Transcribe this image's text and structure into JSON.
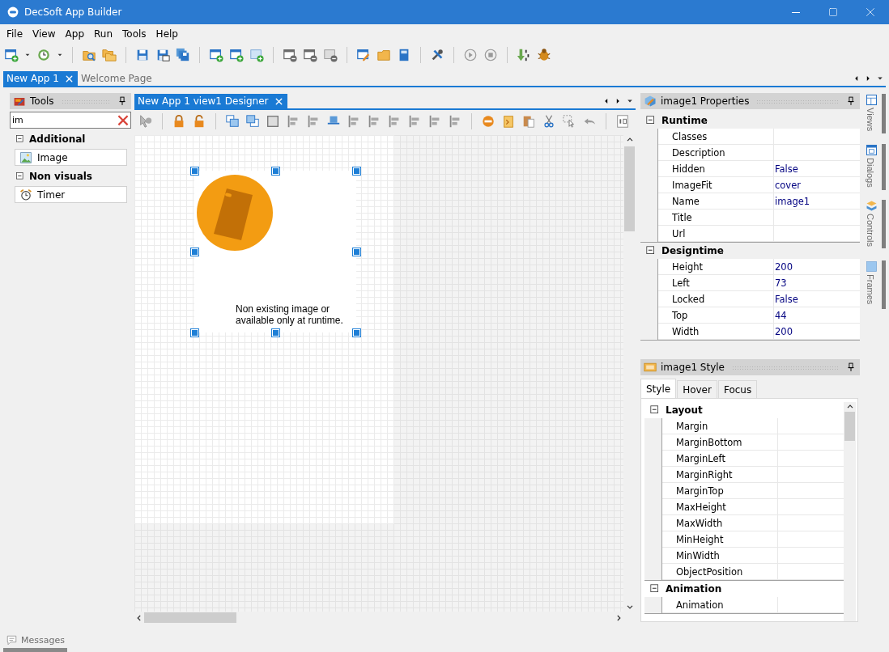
{
  "window": {
    "title": "DecSoft App Builder"
  },
  "menu": [
    "File",
    "View",
    "App",
    "Run",
    "Tools",
    "Help"
  ],
  "doc_tabs": [
    {
      "label": "New App 1",
      "selected": true
    },
    {
      "label": "Welcome Page",
      "selected": false
    }
  ],
  "tools_panel": {
    "title": "Tools",
    "search": {
      "value": "im"
    },
    "groups": [
      {
        "label": "Additional",
        "expanded": true,
        "items": [
          "Image"
        ]
      },
      {
        "label": "Non visuals",
        "expanded": true,
        "items": [
          "Timer"
        ]
      }
    ]
  },
  "designer": {
    "tab": {
      "label": "New App 1 view1 Designer",
      "selected": true
    },
    "image_caption": "Non existing image or available only at runtime."
  },
  "properties": {
    "title": "image1 Properties",
    "sections": [
      {
        "label": "Runtime",
        "expanded": true,
        "rows": [
          {
            "name": "Classes"
          },
          {
            "name": "Description"
          },
          {
            "name": "Hidden",
            "value": "False"
          },
          {
            "name": "ImageFit",
            "value": "cover"
          },
          {
            "name": "Name",
            "value": "image1"
          },
          {
            "name": "Title"
          },
          {
            "name": "Url"
          }
        ]
      },
      {
        "label": "Designtime",
        "expanded": true,
        "rows": [
          {
            "name": "Height",
            "value": "200"
          },
          {
            "name": "Left",
            "value": "73"
          },
          {
            "name": "Locked",
            "value": "False"
          },
          {
            "name": "Top",
            "value": "44"
          },
          {
            "name": "Width",
            "value": "200"
          }
        ]
      }
    ]
  },
  "style_panel": {
    "title": "image1 Style",
    "tabs": [
      {
        "label": "Style",
        "selected": true
      },
      {
        "label": "Hover",
        "selected": false
      },
      {
        "label": "Focus",
        "selected": false
      }
    ],
    "sections": [
      {
        "label": "Layout",
        "expanded": true,
        "rows": [
          {
            "name": "Margin"
          },
          {
            "name": "MarginBottom"
          },
          {
            "name": "MarginLeft"
          },
          {
            "name": "MarginRight"
          },
          {
            "name": "MarginTop"
          },
          {
            "name": "MaxHeight"
          },
          {
            "name": "MaxWidth"
          },
          {
            "name": "MinHeight"
          },
          {
            "name": "MinWidth"
          },
          {
            "name": "ObjectPosition"
          }
        ]
      },
      {
        "label": "Animation",
        "expanded": true,
        "rows": [
          {
            "name": "Animation"
          }
        ]
      }
    ]
  },
  "side_tabs": [
    {
      "label": "Views"
    },
    {
      "label": "Dialogs"
    },
    {
      "label": "Controls"
    },
    {
      "label": "Frames"
    }
  ],
  "bottom_panel": {
    "label": "Messages"
  }
}
